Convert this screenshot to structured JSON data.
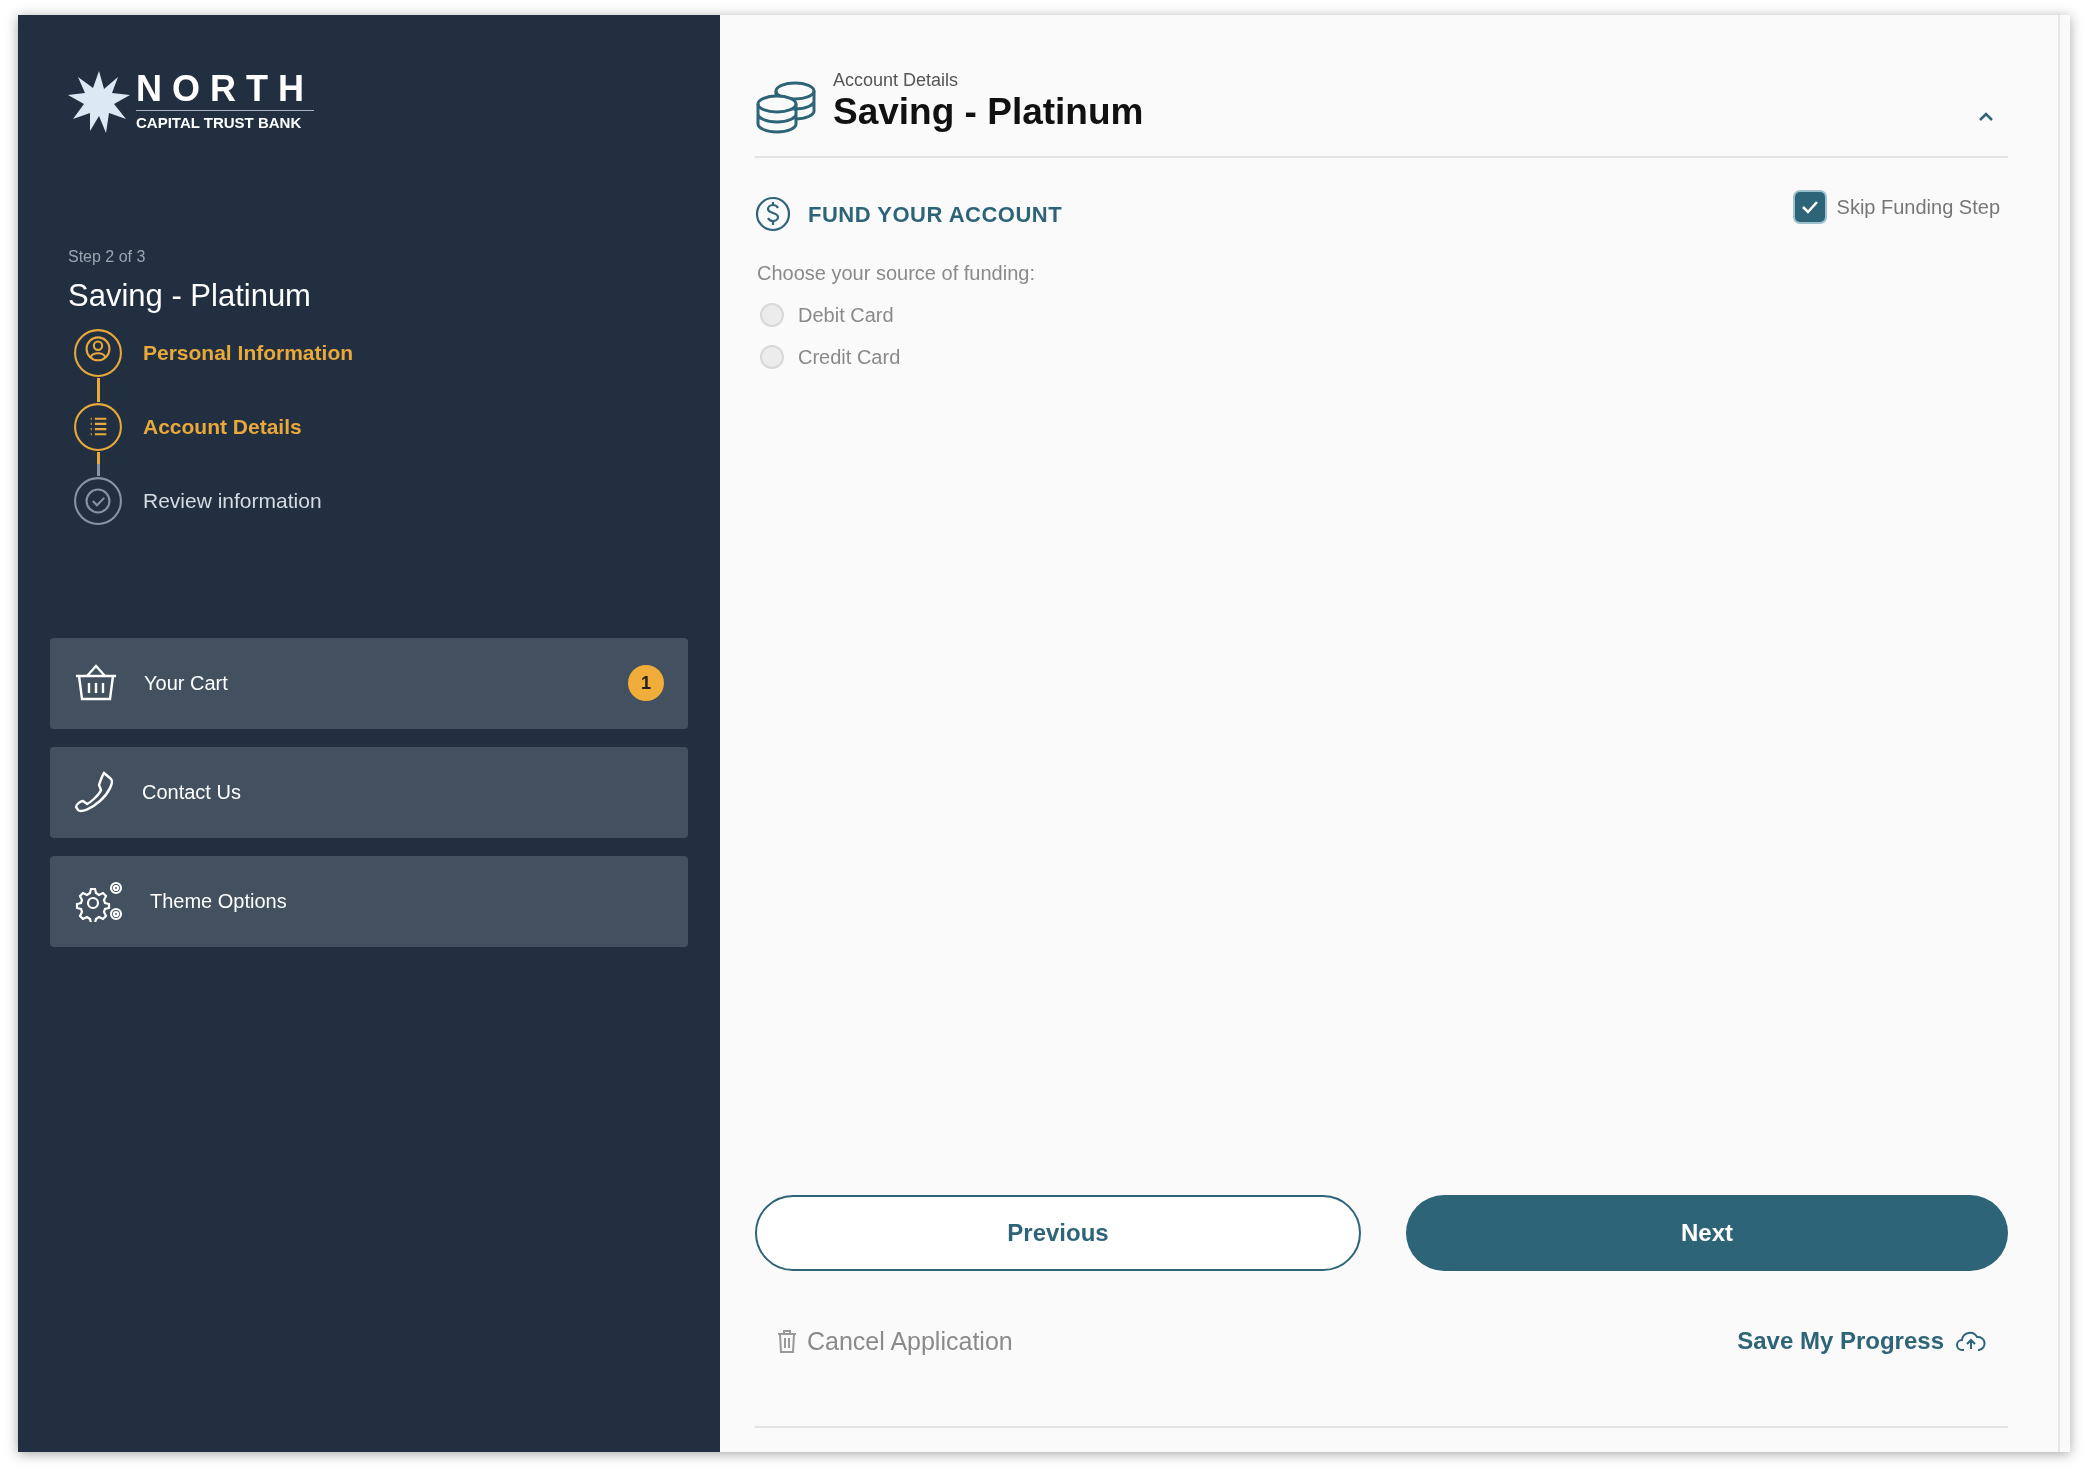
{
  "logo": {
    "name": "NORTH",
    "subtitle": "CAPITAL TRUST BANK"
  },
  "progress": {
    "step": "Step 2 of 3",
    "title": "Saving - Platinum"
  },
  "steps": [
    {
      "label": "Personal Information",
      "active": true
    },
    {
      "label": "Account Details",
      "active": true
    },
    {
      "label": "Review information",
      "active": false
    }
  ],
  "menu": [
    {
      "label": "Your Cart",
      "badge": "1"
    },
    {
      "label": "Contact Us"
    },
    {
      "label": "Theme Options"
    }
  ],
  "header": {
    "eyebrow": "Account Details",
    "title": "Saving - Platinum",
    "expanded": true
  },
  "section": {
    "title": "FUND YOUR ACCOUNT",
    "skip": {
      "label": "Skip Funding Step",
      "checked": true
    }
  },
  "funding": {
    "prompt": "Choose your source of funding:",
    "options": [
      {
        "label": "Debit Card",
        "selected": false
      },
      {
        "label": "Credit Card",
        "selected": false
      }
    ]
  },
  "buttons": {
    "previous": "Previous",
    "next": "Next"
  },
  "footer": {
    "cancel": "Cancel Application",
    "save": "Save My Progress"
  }
}
